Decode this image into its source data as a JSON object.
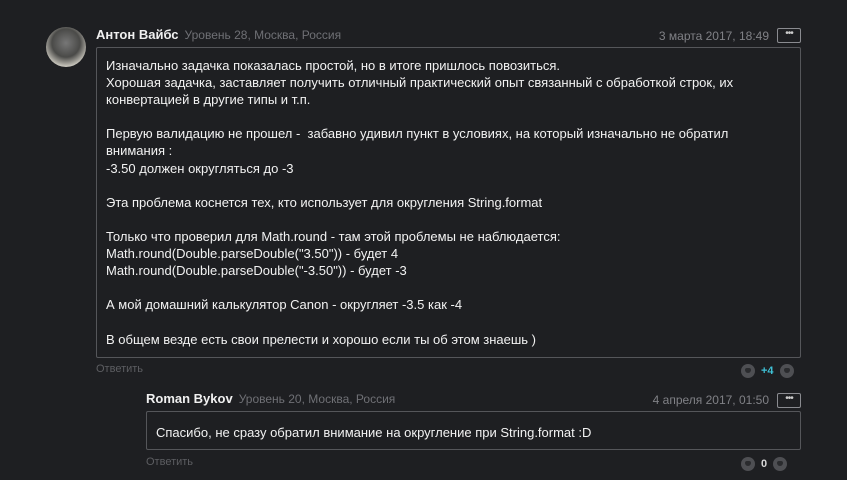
{
  "comment": {
    "author": "Антон Вайбс",
    "meta": "Уровень 28, Москва, Россия",
    "date": "3 марта 2017, 18:49",
    "more_label": "•••",
    "lines": [
      "Изначально задачка показалась простой, но в итоге пришлось повозиться.",
      "Хорошая задачка, заставляет получить отличный практический опыт связанный с обработкой строк, их",
      "конвертацией в другие типы и т.п.",
      "",
      "Первую валидацию не прошел -  забавно удивил пункт в условиях, на который изначально не обратил",
      "внимания :",
      "-3.50 должен округляться до -3",
      "",
      "Эта проблема коснется тех, кто использует для округления String.format",
      "",
      "Только что проверил для Math.round - там этой проблемы не наблюдается:",
      "Math.round(Double.parseDouble(\"3.50\")) - будет 4",
      "Math.round(Double.parseDouble(\"-3.50\")) - будет -3",
      "",
      "А мой домашний калькулятор Canon - округляет -3.5 как -4",
      "",
      "В общем везде есть свои прелести и хорошо если ты об этом знаешь )"
    ],
    "reply_label": "Ответить",
    "score": "+4",
    "score_color": "#3fc1d6"
  },
  "reply": {
    "author": "Roman Bykov",
    "meta": "Уровень 20, Москва, Россия",
    "date": "4 апреля 2017, 01:50",
    "more_label": "•••",
    "text": "Спасибо, не сразу обратил внимание на округление при String.format :D",
    "reply_label": "Ответить",
    "score": "0",
    "score_color": "#d8d8d8"
  }
}
